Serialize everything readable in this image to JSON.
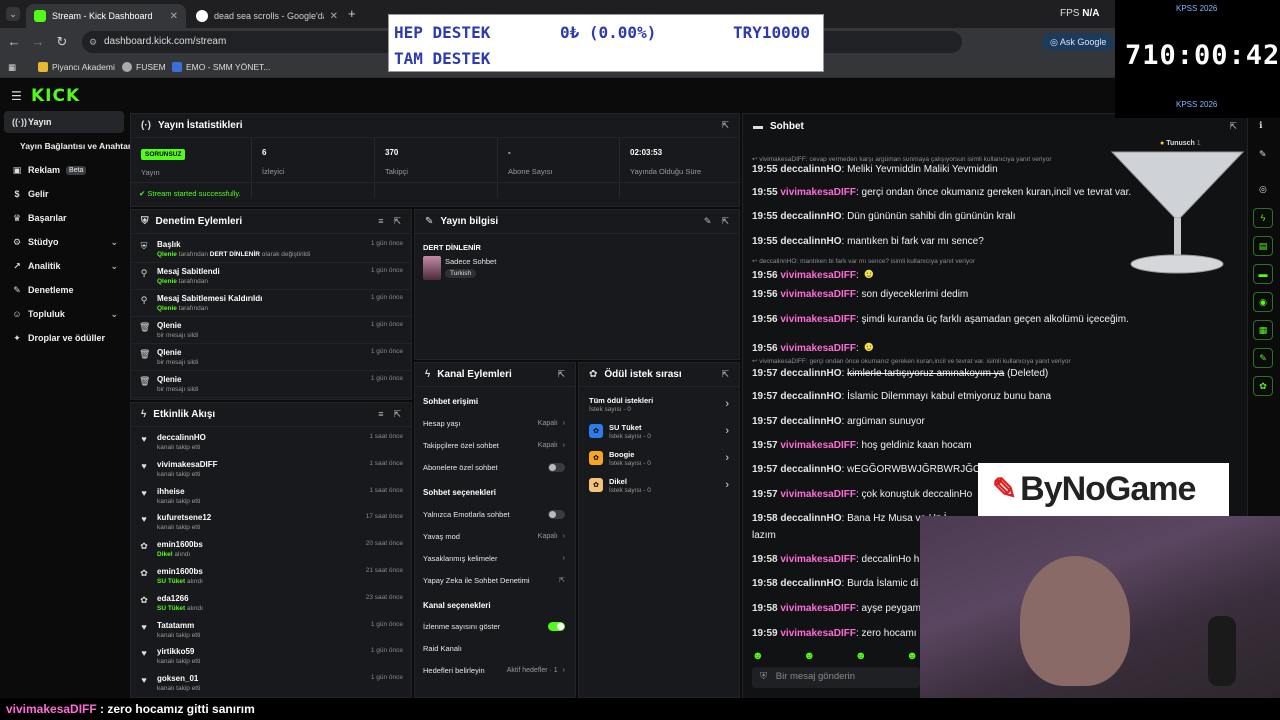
{
  "browser": {
    "tabs": [
      {
        "label": "Stream - Kick Dashboard",
        "active": true
      },
      {
        "label": "dead sea scrolls - Google'da Ara",
        "active": false
      }
    ],
    "url": "dashboard.kick.com/stream",
    "ask_google": "Ask Google",
    "bookmarks": [
      "Piyancı Akademi",
      "FUSEM",
      "EMO - SMM YÖNET..."
    ],
    "fps_label": "FPS",
    "fps_value": "N/A"
  },
  "overlay": {
    "donate_line1_left": "HEP DESTEK",
    "donate_line1_mid": "0₺ (0.00%)",
    "donate_line1_right": "TRY10000",
    "donate_line2": "TAM DESTEK",
    "kpss_top": "KPSS 2026",
    "kpss_timer": "710:00:42",
    "kpss_bottom": "KPSS 2026",
    "bynogame": "ByNoGame",
    "ticker_user": "vivimakesaDIFF",
    "ticker_text": " : zero hocamız gitti sanırım"
  },
  "kick": {
    "logo": "KICK",
    "sidebar": [
      {
        "label": "Yayın",
        "icon": "broadcast-icon",
        "active": true
      },
      {
        "label": "Yayın Bağlantısı ve Anahtarı",
        "icon": "",
        "active": false
      },
      {
        "label": "Reklam",
        "icon": "ad-icon",
        "badge": "Beta"
      },
      {
        "label": "Gelir",
        "icon": "money-icon"
      },
      {
        "label": "Başarılar",
        "icon": "trophy-icon"
      },
      {
        "label": "Stüdyo",
        "icon": "studio-icon",
        "chevron": true
      },
      {
        "label": "Analitik",
        "icon": "chart-icon",
        "chevron": true
      },
      {
        "label": "Denetleme",
        "icon": "wrench-icon"
      },
      {
        "label": "Topluluk",
        "icon": "community-icon",
        "chevron": true
      },
      {
        "label": "Droplar ve ödüller",
        "icon": "gift-icon"
      }
    ],
    "stats": {
      "title": "Yayın İstatistikleri",
      "status_badge": "SORUNSUZ",
      "status_label": "Yayın",
      "viewers": "6",
      "viewers_label": "İzleyici",
      "followers": "370",
      "followers_label": "Takipçi",
      "subs": "-",
      "subs_label": "Abone Sayısı",
      "uptime": "02:03:53",
      "uptime_label": "Yayında Olduğu Süre",
      "message": "Stream started successfully."
    },
    "moderation": {
      "title": "Denetim Eylemleri",
      "rows": [
        {
          "icon": "shield-icon",
          "title": "Başlık",
          "user": "Qlenie",
          "mid": " tarafından ",
          "bold": "DERT DİNLENİR",
          "tail": " olarak değiştirildi",
          "time": "1 gün önce"
        },
        {
          "icon": "pin-icon",
          "title": "Mesaj Sabitlendi",
          "user": "Qlenie",
          "mid": " tarafından",
          "bold": "",
          "tail": "",
          "time": "1 gün önce"
        },
        {
          "icon": "unpin-icon",
          "title": "Mesaj Sabitlemesi Kaldırıldı",
          "user": "Qlenie",
          "mid": " tarafından",
          "bold": "",
          "tail": "",
          "time": "1 gün önce"
        },
        {
          "icon": "trash-icon",
          "title": "Qlenie",
          "user": "",
          "mid": "bir mesajı sildi",
          "bold": "",
          "tail": "",
          "time": "1 gün önce"
        },
        {
          "icon": "trash-icon",
          "title": "Qlenie",
          "user": "",
          "mid": "bir mesajı sildi",
          "bold": "",
          "tail": "",
          "time": "1 gün önce"
        },
        {
          "icon": "trash-icon",
          "title": "Qlenie",
          "user": "",
          "mid": "bir mesajı sildi",
          "bold": "",
          "tail": "",
          "time": "1 gün önce"
        }
      ]
    },
    "info": {
      "title": "Yayın bilgisi",
      "stream_title": "DERT DİNLENİR",
      "category": "Sadece Sohbet",
      "tag": "Turkish"
    },
    "activity": {
      "title": "Etkinlik Akışı",
      "rows": [
        {
          "icon": "heart-icon",
          "user": "deccalinnHO",
          "sub_hl": "",
          "sub": "kanalı takip etti",
          "time": "1 saat önce"
        },
        {
          "icon": "heart-icon",
          "user": "vivimakesaDIFF",
          "sub_hl": "",
          "sub": "kanalı takip etti",
          "time": "1 saat önce"
        },
        {
          "icon": "heart-icon",
          "user": "ihheise",
          "sub_hl": "",
          "sub": "kanalı takip etti",
          "time": "1 saat önce"
        },
        {
          "icon": "heart-icon",
          "user": "kufuretsene12",
          "sub_hl": "",
          "sub": "kanalı takip etti",
          "time": "17 saat önce"
        },
        {
          "icon": "reward-icon",
          "user": "emin1600bs",
          "sub_hl": "Dikel",
          "sub": " alındı",
          "time": "20 saat önce"
        },
        {
          "icon": "reward-icon",
          "user": "emin1600bs",
          "sub_hl": "SU Tüket",
          "sub": " alındı",
          "time": "21 saat önce"
        },
        {
          "icon": "reward-icon",
          "user": "eda1266",
          "sub_hl": "SU Tüket",
          "sub": " alındı",
          "time": "23 saat önce"
        },
        {
          "icon": "heart-icon",
          "user": "Tatatamm",
          "sub_hl": "",
          "sub": "kanalı takip etti",
          "time": "1 gün önce"
        },
        {
          "icon": "heart-icon",
          "user": "yirtikko59",
          "sub_hl": "",
          "sub": "kanalı takip etti",
          "time": "1 gün önce"
        },
        {
          "icon": "heart-icon",
          "user": "goksen_01",
          "sub_hl": "",
          "sub": "kanalı takip etti",
          "time": "1 gün önce"
        }
      ]
    },
    "channel": {
      "title": "Kanal Eylemleri",
      "items": [
        {
          "label": "Sohbet erişimi",
          "type": "section"
        },
        {
          "label": "Hesap yaşı",
          "value": "Kapalı",
          "type": "link"
        },
        {
          "label": "Takipçilere özel sohbet",
          "value": "Kapalı",
          "type": "link"
        },
        {
          "label": "Abonelere özel sohbet",
          "type": "toggle",
          "on": false
        },
        {
          "label": "Sohbet seçenekleri",
          "type": "section"
        },
        {
          "label": "Yalnızca Emotlarla sohbet",
          "type": "toggle",
          "on": false
        },
        {
          "label": "Yavaş mod",
          "value": "Kapalı",
          "type": "link"
        },
        {
          "label": "Yasaklanmış kelimeler",
          "type": "link"
        },
        {
          "label": "Yapay Zeka ile Sohbet Denetimi",
          "type": "ext"
        },
        {
          "label": "Kanal seçenekleri",
          "type": "section"
        },
        {
          "label": "İzlenme sayısını göster",
          "type": "toggle",
          "on": true
        },
        {
          "label": "Raid Kanalı",
          "type": "plain"
        },
        {
          "label": "Hedefleri belirleyin",
          "value": "Aktif hedefler · 1",
          "type": "link"
        }
      ]
    },
    "rewards": {
      "title": "Ödül istek sırası",
      "all_label": "Tüm ödül istekleri",
      "all_sub": "İstek sayısı - 0",
      "items": [
        {
          "name": "SU Tüket",
          "sub": "İstek sayısı - 0",
          "color": "#2b7de9"
        },
        {
          "name": "Boogie",
          "sub": "İstek sayısı - 0",
          "color": "#f5a623"
        },
        {
          "name": "Dikel",
          "sub": "İstek sayısı - 0",
          "color": "#f5c27a"
        }
      ]
    },
    "chat": {
      "title": "Sohbet",
      "pinned_user": "Tunusch",
      "pinned_count": "1",
      "input_placeholder": "Bir mesaj gönderin",
      "footer_points": "0",
      "lines": [
        {
          "type": "sys",
          "text": "vivimakesaDIFF: cevap vermeden karşı argüman sunmaya çalışıyorsun isimli kullanıcıya yanıt veriyor"
        },
        {
          "type": "msg",
          "ts": "19:55",
          "user": "deccalinnHO",
          "color": "u1",
          "text": "Meliki Yevmiddin Maliki Yevmiddin"
        },
        {
          "type": "msg",
          "ts": "19:55",
          "user": "vivimakesaDIFF",
          "color": "u2",
          "text": "gerçi ondan önce okumanız gereken kuran,incil ve tevrat var."
        },
        {
          "type": "msg",
          "ts": "19:55",
          "user": "deccalinnHO",
          "color": "u1",
          "text": "Dün gününün sahibi din gününün kralı"
        },
        {
          "type": "msg",
          "ts": "19:55",
          "user": "deccalinnHO",
          "color": "u1",
          "text": "mantıken bi fark var mı sence?"
        },
        {
          "type": "sys",
          "text": "deccalinnHO: mantıken bi fark var mı sence? isimli kullanıcıya yanıt veriyor"
        },
        {
          "type": "msg",
          "ts": "19:56",
          "user": "vivimakesaDIFF",
          "color": "u2",
          "text": "",
          "emote": true
        },
        {
          "type": "msg",
          "ts": "19:56",
          "user": "vivimakesaDIFF",
          "color": "u2",
          "text": "son diyeceklerimi dedim"
        },
        {
          "type": "msg",
          "ts": "19:56",
          "user": "vivimakesaDIFF",
          "color": "u2",
          "text": "şimdi kuranda üç farklı aşamadan geçen alkolümü içeceğim."
        },
        {
          "type": "msg",
          "ts": "19:56",
          "user": "vivimakesaDIFF",
          "color": "u2",
          "text": "",
          "emote": true
        },
        {
          "type": "sys",
          "text": "vivimakesaDIFF: gerçi ondan önce okumanız gereken kuran,incil ve tevrat var. isimli kullanıcıya yanıt veriyor"
        },
        {
          "type": "msg",
          "ts": "19:57",
          "user": "deccalinnHO",
          "color": "u1",
          "text": "kimlerle tartışıyoruz amınakoyım ya",
          "deleted": "(Deleted)"
        },
        {
          "type": "msg",
          "ts": "19:57",
          "user": "deccalinnHO",
          "color": "u1",
          "text": "İslamic Dilemmayı kabul etmiyoruz bunu bana"
        },
        {
          "type": "msg",
          "ts": "19:57",
          "user": "deccalinnHO",
          "color": "u1",
          "text": "argüman sunuyor"
        },
        {
          "type": "msg",
          "ts": "19:57",
          "user": "vivimakesaDIFF",
          "color": "u2",
          "text": "hoş geldiniz kaan hocam"
        },
        {
          "type": "msg",
          "ts": "19:57",
          "user": "deccalinnHO",
          "color": "u1",
          "text": "wEGĞORWBWJĞRBWRJĞOI"
        },
        {
          "type": "msg",
          "ts": "19:57",
          "user": "vivimakesaDIFF",
          "color": "u2",
          "text": "çok konuştuk deccalinHo"
        },
        {
          "type": "msg",
          "ts": "19:58",
          "user": "deccalinnHO",
          "color": "u1",
          "text": "Bana Hz Musa ve Hz İ"
        },
        {
          "type": "cont",
          "text": "lazım"
        },
        {
          "type": "msg",
          "ts": "19:58",
          "user": "vivimakesaDIFF",
          "color": "u2",
          "text": "deccalinHo h"
        },
        {
          "type": "msg",
          "ts": "19:58",
          "user": "deccalinnHO",
          "color": "u1",
          "text": "Burda İslamic di"
        },
        {
          "type": "msg",
          "ts": "19:58",
          "user": "vivimakesaDIFF",
          "color": "u2",
          "text": "ayşe peygam"
        },
        {
          "type": "msg",
          "ts": "19:59",
          "user": "vivimakesaDIFF",
          "color": "u2",
          "text": "zero hocamı"
        }
      ]
    }
  },
  "colors": {
    "kick_green": "#53fc18",
    "username_pink": "#ff6bd7",
    "panel_bg": "#18191c"
  }
}
